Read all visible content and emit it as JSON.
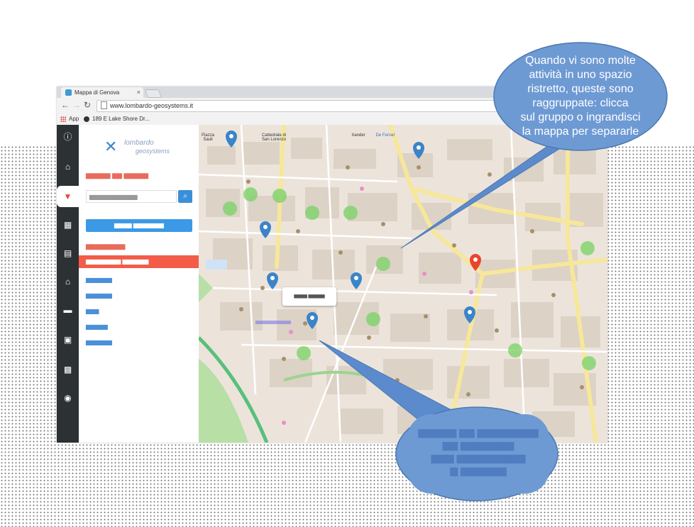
{
  "browser": {
    "tab_title": "Mappa di Genova",
    "tab_close": "×",
    "url": "www.lombardo-geosystems.it",
    "bookmarks": [
      {
        "label": "App"
      },
      {
        "label": "189 E Lake Shore Dr..."
      }
    ]
  },
  "sidebar": {
    "icons": [
      "info-icon",
      "home-icon",
      "shirt-icon",
      "layers-icon",
      "store-icon",
      "house-icon",
      "bus-icon",
      "bag-icon",
      "briefcase-icon",
      "bank-icon"
    ],
    "active_index": 2
  },
  "map": {
    "labels": [
      {
        "text": "Piazza Sauli"
      },
      {
        "text": "Cattedrale di San Lorenzo"
      },
      {
        "text": "Xander"
      },
      {
        "text": "De Ferrari"
      }
    ],
    "cluster_color": "#7fd36a",
    "marker_color": "#3b84c9",
    "selected_marker_color": "#e8452c"
  },
  "callouts": {
    "top": {
      "lines": [
        "Quando vi sono molte",
        "attività in uno spazio",
        "ristretto, queste sono",
        "raggruppate: clicca",
        "sul gruppo o ingrandisci",
        "la mappa per separarle"
      ],
      "fill": "#6e9ad4",
      "text_color": "#ffffff"
    }
  }
}
